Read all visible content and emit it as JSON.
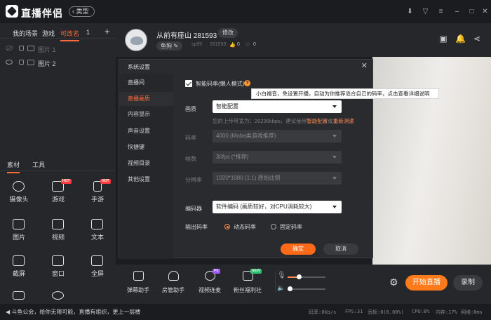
{
  "app": {
    "logo": "直播伴侣",
    "type_button": "类型"
  },
  "scene_tabs": [
    "我的场景",
    "游戏",
    "可改名",
    "1"
  ],
  "scenes": [
    {
      "name": "图片 1",
      "visible": false
    },
    {
      "name": "图片 2",
      "visible": true
    }
  ],
  "source_tabs": [
    "素材",
    "工具"
  ],
  "tools": [
    {
      "label": "摄像头",
      "icon": "camera-icon",
      "hot": ""
    },
    {
      "label": "游戏",
      "icon": "gamepad-icon",
      "hot": "HOT"
    },
    {
      "label": "手游",
      "icon": "phone-icon",
      "hot": "HOT"
    },
    {
      "label": "图片",
      "icon": "image-icon",
      "hot": ""
    },
    {
      "label": "视频",
      "icon": "video-icon",
      "hot": ""
    },
    {
      "label": "文本",
      "icon": "text-icon",
      "hot": ""
    },
    {
      "label": "截屏",
      "icon": "crop-icon",
      "hot": ""
    },
    {
      "label": "窗口",
      "icon": "window-icon",
      "hot": ""
    },
    {
      "label": "全屏",
      "icon": "fullscreen-icon",
      "hot": ""
    }
  ],
  "stream": {
    "title": "从前有座山 281593",
    "rename": "修改",
    "category": "鱼狗",
    "meta_id": "sp95",
    "meta_num": "281593",
    "likes": "0",
    "fans": "0"
  },
  "dialog": {
    "title": "系统设置",
    "nav": [
      "直播间",
      "直播画质",
      "内容显示",
      "声音设置",
      "快捷键",
      "视频目录",
      "其他设置"
    ],
    "smart_rate_label": "智能码率(懒人模式)",
    "help": "?",
    "tooltip": "小白福音，免设置开播，自动为你推荐适合自己的码率，点击查看详细说明",
    "quality_label": "画质",
    "quality_value": "智能配置",
    "upload_hint_prefix": "您的上传带宽为：20236kbps，建议使用",
    "upload_hint_link1": "智能配置",
    "upload_hint_mid": "或",
    "upload_hint_link2": "重新测速",
    "bitrate_label": "码率",
    "bitrate_value": "4000 (Moba类游戏推荐)",
    "fps_label": "帧数",
    "fps_value": "30fps (*推荐)",
    "res_label": "分辨率",
    "res_value": "1920*1080 (1:1) 原始比例",
    "encoder_label": "编码器",
    "encoder_value": "软件编码 (画质较好，对CPU消耗较大)",
    "output_label": "输出码率",
    "output_dynamic": "动态码率",
    "output_fixed": "固定码率",
    "ok": "确定",
    "cancel": "取消"
  },
  "bottom": {
    "tools": [
      {
        "label": "弹幕助手",
        "tag": ""
      },
      {
        "label": "房管助手",
        "tag": ""
      },
      {
        "label": "视频连麦",
        "tag": "PK"
      },
      {
        "label": "粉丝福利社",
        "tag": "NEW"
      }
    ],
    "mic_level": 0.3,
    "speaker_level": 0.05,
    "start_live": "开始直播",
    "record": "录制"
  },
  "status": {
    "notice": "斗鱼公会，给你无限可能，直播有组织，更上一层楼",
    "bitrate": "码率:0kb/s",
    "fps": "FPS:31",
    "dropped": "丢帧:0(0.00%)",
    "cpu": "CPU:8%",
    "mem": "内存:17%",
    "net": "网络:0ms"
  },
  "colors": {
    "accent": "#ff6a1a",
    "panel": "#26272b",
    "bar": "#1b1c1f"
  }
}
